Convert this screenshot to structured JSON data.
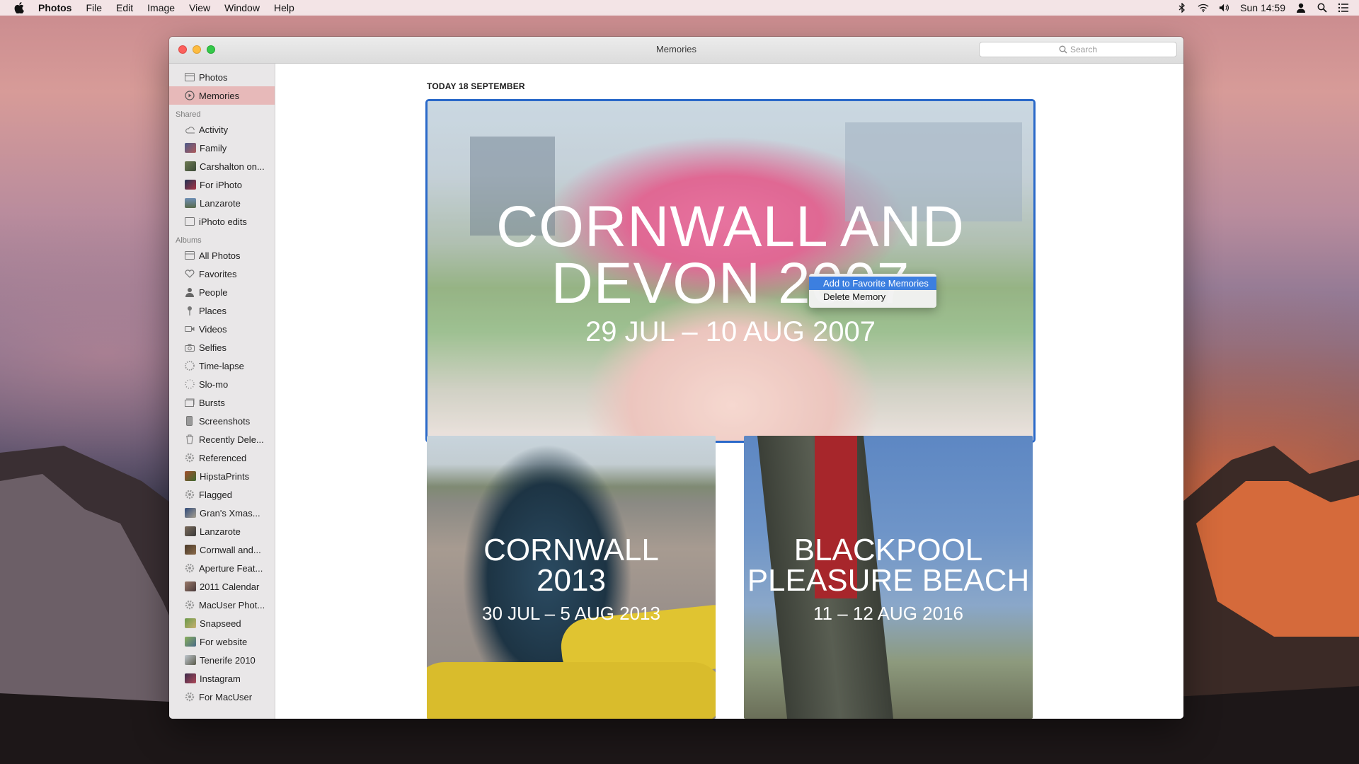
{
  "menubar": {
    "app_name": "Photos",
    "menus": [
      "File",
      "Edit",
      "Image",
      "View",
      "Window",
      "Help"
    ],
    "clock": "Sun 14:59",
    "icons": [
      "bluetooth-icon",
      "wifi-icon",
      "volume-icon",
      "user-icon",
      "spotlight-icon",
      "notification-center-icon"
    ]
  },
  "window": {
    "title": "Memories",
    "search_placeholder": "Search"
  },
  "sidebar": {
    "top_items": [
      {
        "label": "Photos",
        "icon": "photos-icon"
      },
      {
        "label": "Memories",
        "icon": "memories-icon",
        "selected": true
      }
    ],
    "shared_header": "Shared",
    "shared_items": [
      {
        "label": "Activity",
        "icon": "cloud-icon"
      },
      {
        "label": "Family",
        "icon": "thumbnail"
      },
      {
        "label": "Carshalton on...",
        "icon": "thumbnail"
      },
      {
        "label": "For iPhoto",
        "icon": "thumbnail"
      },
      {
        "label": "Lanzarote",
        "icon": "thumbnail"
      },
      {
        "label": "iPhoto edits",
        "icon": "album-icon"
      }
    ],
    "albums_header": "Albums",
    "album_items": [
      {
        "label": "All Photos",
        "icon": "album-icon"
      },
      {
        "label": "Favorites",
        "icon": "heart-icon"
      },
      {
        "label": "People",
        "icon": "person-icon"
      },
      {
        "label": "Places",
        "icon": "pin-icon"
      },
      {
        "label": "Videos",
        "icon": "video-icon"
      },
      {
        "label": "Selfies",
        "icon": "camera-icon"
      },
      {
        "label": "Time-lapse",
        "icon": "timelapse-icon"
      },
      {
        "label": "Slo-mo",
        "icon": "slomo-icon"
      },
      {
        "label": "Bursts",
        "icon": "bursts-icon"
      },
      {
        "label": "Screenshots",
        "icon": "screenshot-icon"
      },
      {
        "label": "Recently Dele...",
        "icon": "trash-icon"
      },
      {
        "label": "Referenced",
        "icon": "gear-icon"
      },
      {
        "label": "HipstaPrints",
        "icon": "thumbnail"
      },
      {
        "label": "Flagged",
        "icon": "gear-icon"
      },
      {
        "label": "Gran's Xmas...",
        "icon": "thumbnail"
      },
      {
        "label": "Lanzarote",
        "icon": "thumbnail"
      },
      {
        "label": "Cornwall and...",
        "icon": "thumbnail"
      },
      {
        "label": "Aperture Feat...",
        "icon": "gear-icon"
      },
      {
        "label": "2011 Calendar",
        "icon": "thumbnail"
      },
      {
        "label": "MacUser Phot...",
        "icon": "gear-icon"
      },
      {
        "label": "Snapseed",
        "icon": "thumbnail"
      },
      {
        "label": "For website",
        "icon": "thumbnail"
      },
      {
        "label": "Tenerife 2010",
        "icon": "thumbnail"
      },
      {
        "label": "Instagram",
        "icon": "thumbnail"
      },
      {
        "label": "For MacUser",
        "icon": "gear-icon"
      }
    ]
  },
  "content": {
    "section_date": "TODAY 18 SEPTEMBER",
    "hero": {
      "title_line1": "CORNWALL AND",
      "title_line2": "DEVON 2007",
      "dates": "29 JUL – 10 AUG 2007"
    },
    "context_menu": {
      "items": [
        "Add to Favorite Memories",
        "Delete Memory"
      ],
      "highlighted": 0
    },
    "cards": [
      {
        "title_line1": "CORNWALL",
        "title_line2": "2013",
        "dates": "30 JUL – 5 AUG 2013"
      },
      {
        "title_line1": "BLACKPOOL",
        "title_line2": "PLEASURE BEACH",
        "dates": "11 – 12 AUG 2016"
      }
    ]
  },
  "colors": {
    "selection_border": "#2a69c9",
    "sidebar_selected": "#e7b9b9",
    "menu_highlight": "#3c7fe0"
  }
}
